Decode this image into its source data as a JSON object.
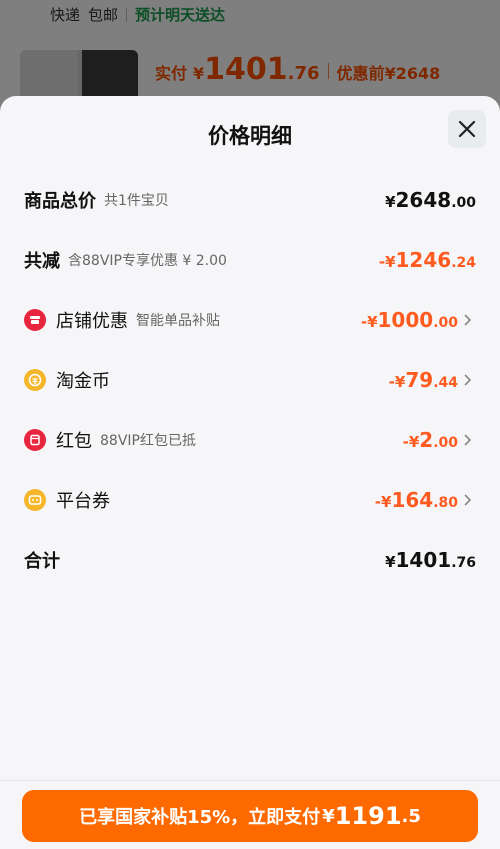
{
  "background": {
    "shipping_express": "快递",
    "shipping_free": "包邮",
    "shipping_eta": "预计明天送达",
    "price_label": "实付",
    "price_yen": "¥",
    "price_int": "1401",
    "price_dec": ".76",
    "original_label": "优惠前",
    "original_price": "¥2648"
  },
  "sheet": {
    "title": "价格明细",
    "close_icon": "close-icon"
  },
  "rows": {
    "total": {
      "label": "商品总价",
      "sub": "共1件宝贝",
      "yen": "¥",
      "int": "2648",
      "dec": ".00"
    },
    "reduce": {
      "label": "共减",
      "sub": "含88VIP专享优惠 ¥ 2.00",
      "yen": "-¥",
      "int": "1246",
      "dec": ".24"
    },
    "store": {
      "label": "店铺优惠",
      "sub": "智能单品补贴",
      "yen": "-¥",
      "int": "1000",
      "dec": ".00",
      "icon": "store-icon",
      "icon_color": "#e8263f"
    },
    "coin": {
      "label": "淘金币",
      "yen": "-¥",
      "int": "79",
      "dec": ".44",
      "icon": "coin-icon",
      "icon_color": "#f5b62a"
    },
    "redpacket": {
      "label": "红包",
      "sub": "88VIP红包已抵",
      "yen": "-¥",
      "int": "2",
      "dec": ".00",
      "icon": "red-packet-icon",
      "icon_color": "#e8263f"
    },
    "coupon": {
      "label": "平台券",
      "yen": "-¥",
      "int": "164",
      "dec": ".80",
      "icon": "coupon-icon",
      "icon_color": "#f5b62a"
    },
    "sum": {
      "label": "合计",
      "yen": "¥",
      "int": "1401",
      "dec": ".76"
    }
  },
  "pay_button": {
    "text": "已享国家补贴15%，立即支付",
    "yen": "¥",
    "int": "1191",
    "dec": ".5"
  },
  "colors": {
    "accent": "#ff6a00",
    "discount": "#ff5a1f",
    "green": "#1a9d4e"
  }
}
